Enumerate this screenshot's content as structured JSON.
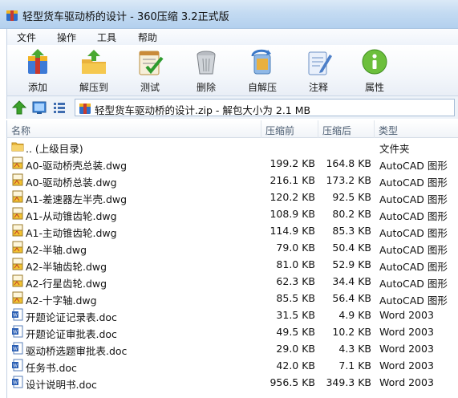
{
  "window": {
    "title": "轻型货车驱动桥的设计 - 360压缩 3.2正式版"
  },
  "menu": [
    "文件",
    "操作",
    "工具",
    "帮助"
  ],
  "toolbar": [
    {
      "label": "添加",
      "icon": "add-archive-icon"
    },
    {
      "label": "解压到",
      "icon": "extract-icon"
    },
    {
      "label": "测试",
      "icon": "test-icon"
    },
    {
      "label": "删除",
      "icon": "delete-icon"
    },
    {
      "label": "自解压",
      "icon": "self-extract-icon"
    },
    {
      "label": "注释",
      "icon": "comment-icon"
    },
    {
      "label": "属性",
      "icon": "info-icon"
    }
  ],
  "address": {
    "path": "轻型货车驱动桥的设计.zip - 解包大小为 2.1 MB"
  },
  "columns": {
    "name": "名称",
    "compressed": "压缩前",
    "original": "压缩后",
    "type": "类型"
  },
  "files": [
    {
      "name": ".. (上级目录)",
      "compressed": "",
      "original": "",
      "type": "文件夹",
      "kind": "folder"
    },
    {
      "name": "A0-驱动桥壳总装.dwg",
      "compressed": "199.2 KB",
      "original": "164.8 KB",
      "type": "AutoCAD 图形",
      "kind": "dwg"
    },
    {
      "name": "A0-驱动桥总装.dwg",
      "compressed": "216.1 KB",
      "original": "173.2 KB",
      "type": "AutoCAD 图形",
      "kind": "dwg"
    },
    {
      "name": "A1-差速器左半壳.dwg",
      "compressed": "120.2 KB",
      "original": "92.5 KB",
      "type": "AutoCAD 图形",
      "kind": "dwg"
    },
    {
      "name": "A1-从动锥齿轮.dwg",
      "compressed": "108.9 KB",
      "original": "80.2 KB",
      "type": "AutoCAD 图形",
      "kind": "dwg"
    },
    {
      "name": "A1-主动锥齿轮.dwg",
      "compressed": "114.9 KB",
      "original": "85.3 KB",
      "type": "AutoCAD 图形",
      "kind": "dwg"
    },
    {
      "name": "A2-半轴.dwg",
      "compressed": "79.0 KB",
      "original": "50.4 KB",
      "type": "AutoCAD 图形",
      "kind": "dwg"
    },
    {
      "name": "A2-半轴齿轮.dwg",
      "compressed": "81.0 KB",
      "original": "52.9 KB",
      "type": "AutoCAD 图形",
      "kind": "dwg"
    },
    {
      "name": "A2-行星齿轮.dwg",
      "compressed": "62.3 KB",
      "original": "34.4 KB",
      "type": "AutoCAD 图形",
      "kind": "dwg"
    },
    {
      "name": "A2-十字轴.dwg",
      "compressed": "85.5 KB",
      "original": "56.4 KB",
      "type": "AutoCAD 图形",
      "kind": "dwg"
    },
    {
      "name": "开题论证记录表.doc",
      "compressed": "31.5 KB",
      "original": "4.9 KB",
      "type": "Word 2003",
      "kind": "doc"
    },
    {
      "name": "开题论证审批表.doc",
      "compressed": "49.5 KB",
      "original": "10.2 KB",
      "type": "Word 2003",
      "kind": "doc"
    },
    {
      "name": "驱动桥选题审批表.doc",
      "compressed": "29.0 KB",
      "original": "4.3 KB",
      "type": "Word 2003",
      "kind": "doc"
    },
    {
      "name": "任务书.doc",
      "compressed": "42.0 KB",
      "original": "7.1 KB",
      "type": "Word 2003",
      "kind": "doc"
    },
    {
      "name": "设计说明书.doc",
      "compressed": "956.5 KB",
      "original": "349.3 KB",
      "type": "Word 2003",
      "kind": "doc"
    }
  ],
  "colors": {
    "title_bar": "#c4dbf2",
    "word_blue": "#2b5fb4",
    "dwg_yellow": "#f1c232"
  }
}
